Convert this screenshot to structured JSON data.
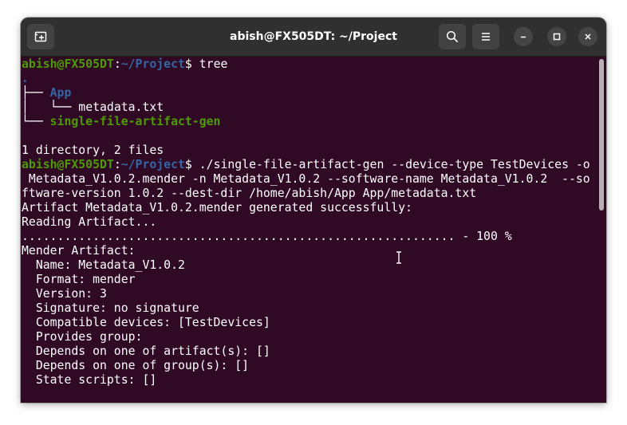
{
  "window": {
    "title": "abish@FX505DT: ~/Project"
  },
  "icons": {
    "new_tab": "new-tab-icon",
    "search": "search-icon",
    "menu": "hamburger-menu-icon",
    "minimize": "minimize-icon",
    "maximize": "maximize-icon",
    "close": "close-icon"
  },
  "colors": {
    "terminal_bg": "#300a24",
    "titlebar_bg": "#303030",
    "prompt_user": "#4e9a06",
    "prompt_path": "#3465a4",
    "directory": "#3465a4",
    "executable": "#4e9a06"
  },
  "terminal": {
    "prompt1": {
      "user": "abish@FX505DT",
      "sep": ":",
      "path": "~/Project",
      "sym": "$ ",
      "cmd": "tree"
    },
    "tree_root": ".",
    "tree_app_prefix": "├── ",
    "tree_app": "App",
    "tree_meta_prefix": "│   └── ",
    "tree_meta": "metadata.txt",
    "tree_gen_prefix": "└── ",
    "tree_gen": "single-file-artifact-gen",
    "summary": "1 directory, 2 files",
    "prompt2": {
      "user": "abish@FX505DT",
      "sep": ":",
      "path": "~/Project",
      "sym": "$ ",
      "cmd": "./single-file-artifact-gen --device-type TestDevices -o"
    },
    "cmd_wrap1": " Metadata_V1.0.2.mender -n Metadata_V1.0.2 --software-name Metadata_V1.0.2  --so",
    "cmd_wrap2": "ftware-version 1.0.2 --dest-dir /home/abish/App App/metadata.txt",
    "out_generated": "Artifact Metadata_V1.0.2.mender generated successfully:",
    "out_reading": "Reading Artifact...",
    "out_progress": "............................................................. - 100 %",
    "out_mender": "Mender Artifact:",
    "out_name": "  Name: Metadata_V1.0.2",
    "out_format": "  Format: mender",
    "out_version": "  Version: 3",
    "out_signature": "  Signature: no signature",
    "out_devices": "  Compatible devices: [TestDevices]",
    "out_provides": "  Provides group:",
    "out_depends_art": "  Depends on one of artifact(s): []",
    "out_depends_grp": "  Depends on one of group(s): []",
    "out_state": "  State scripts: []"
  }
}
